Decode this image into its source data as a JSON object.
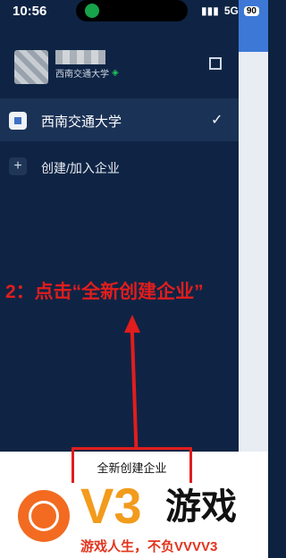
{
  "status": {
    "time": "10:56",
    "network": "5G",
    "battery": "90"
  },
  "profile": {
    "org_subtitle": "西南交通大学"
  },
  "menu": {
    "org_name": "西南交通大学",
    "create_join": "创建/加入企业"
  },
  "overlay": {
    "instruction": "2：点击“全新创建企业”"
  },
  "bottom": {
    "new_button": "全新创建企业"
  },
  "watermark": {
    "brand": "V3",
    "brand_cn": "游戏",
    "slogan": "游戏人生，不负VVVV3"
  },
  "colors": {
    "drawer": "#0f2444",
    "accent_red": "#e11d1d",
    "brand_orange": "#f26b21"
  }
}
